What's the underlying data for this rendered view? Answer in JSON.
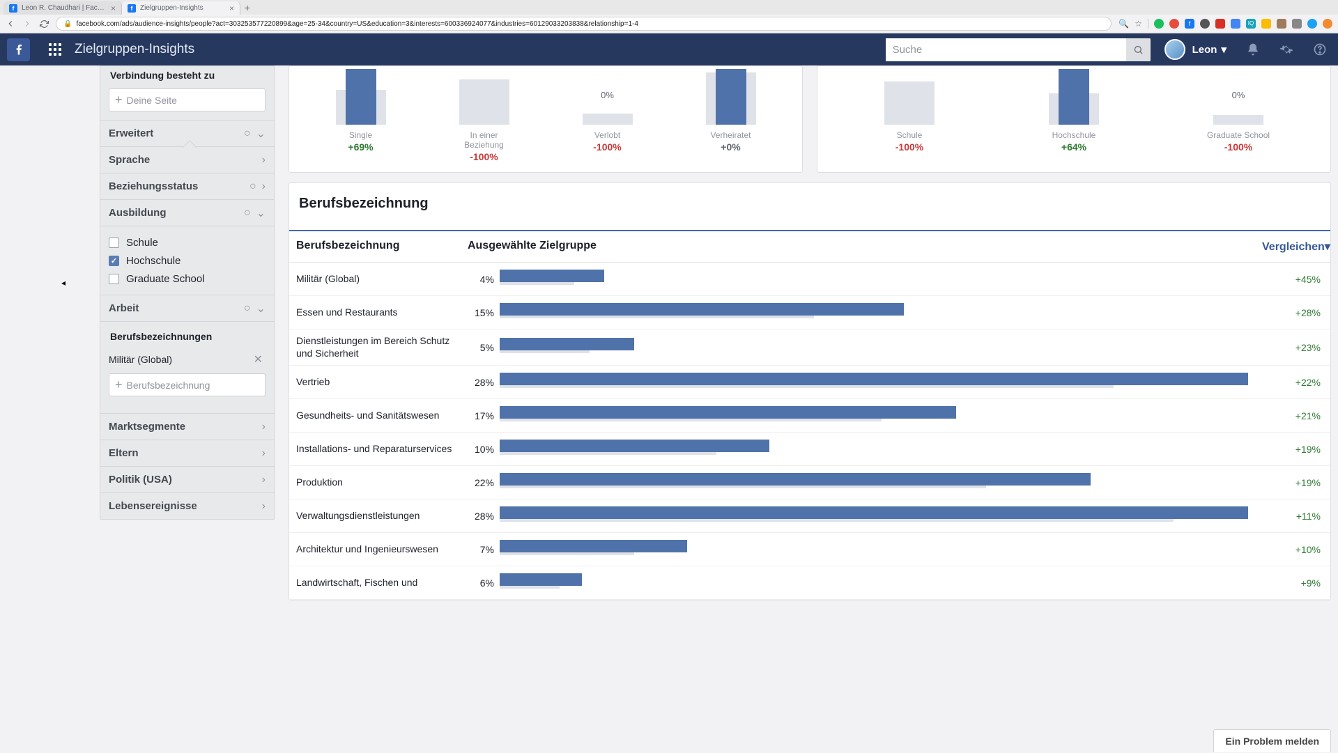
{
  "browser": {
    "tabs": [
      {
        "title": "Leon R. Chaudhari | Facebook",
        "active": false
      },
      {
        "title": "Zielgruppen-Insights",
        "active": true
      }
    ],
    "url": "facebook.com/ads/audience-insights/people?act=303253577220899&age=25-34&country=US&education=3&interests=600336924077&industries=60129033203838&relationship=1-4"
  },
  "header": {
    "page_title": "Zielgruppen-Insights",
    "search_placeholder": "Suche",
    "user_name": "Leon"
  },
  "sidebar": {
    "verbindung_title": "Verbindung besteht zu",
    "deine_seite_ph": "Deine Seite",
    "erw": "Erweitert",
    "sprache": "Sprache",
    "beziehung": "Beziehungsstatus",
    "ausbildung": "Ausbildung",
    "edu_opts": {
      "schule": "Schule",
      "hochschule": "Hochschule",
      "grad": "Graduate School"
    },
    "arbeit": "Arbeit",
    "beruf_title": "Berufsbezeichnungen",
    "beruf_tag": "Militär (Global)",
    "beruf_ph": "Berufsbezeichnung",
    "markt": "Marktsegmente",
    "eltern": "Eltern",
    "politik": "Politik (USA)",
    "leben": "Lebensereignisse"
  },
  "charts": {
    "left": {
      "top_pct": "0%",
      "free_pct": "0%",
      "cols": [
        {
          "label": "Single",
          "delta": "+69%",
          "cls": "pos",
          "fg": 80,
          "bg": 50
        },
        {
          "label": "In einer Beziehung",
          "delta": "-100%",
          "cls": "neg",
          "fg": 0,
          "bg": 65
        },
        {
          "label": "Verlobt",
          "delta": "-100%",
          "cls": "neg",
          "fg": 0,
          "bg": 16
        },
        {
          "label": "Verheiratet",
          "delta": "+0%",
          "cls": "neu",
          "fg": 80,
          "bg": 75
        }
      ]
    },
    "right": {
      "top_pct": "0%",
      "free_pct": "0%",
      "cols": [
        {
          "label": "Schule",
          "delta": "-100%",
          "cls": "neg",
          "fg": 0,
          "bg": 62
        },
        {
          "label": "Hochschule",
          "delta": "+64%",
          "cls": "pos",
          "fg": 80,
          "bg": 45
        },
        {
          "label": "Graduate School",
          "delta": "-100%",
          "cls": "neg",
          "fg": 0,
          "bg": 14
        }
      ]
    }
  },
  "table": {
    "title": "Berufsbezeichnung",
    "h_name": "Berufsbezeichnung",
    "h_bar": "Ausgewählte Zielgruppe",
    "h_cmp": "Vergleichen",
    "rows": [
      {
        "name": "Militär (Global)",
        "pct": "4%",
        "fg": 14,
        "bg": 10,
        "delta": "+45%",
        "cls": "pos"
      },
      {
        "name": "Essen und Restaurants",
        "pct": "15%",
        "fg": 54,
        "bg": 42,
        "delta": "+28%",
        "cls": "pos"
      },
      {
        "name": "Dienstleistungen im Bereich Schutz und Sicherheit",
        "pct": "5%",
        "fg": 18,
        "bg": 12,
        "delta": "+23%",
        "cls": "pos"
      },
      {
        "name": "Vertrieb",
        "pct": "28%",
        "fg": 100,
        "bg": 82,
        "delta": "+22%",
        "cls": "pos"
      },
      {
        "name": "Gesundheits- und Sanitätswesen",
        "pct": "17%",
        "fg": 61,
        "bg": 51,
        "delta": "+21%",
        "cls": "pos"
      },
      {
        "name": "Installations- und Reparaturservices",
        "pct": "10%",
        "fg": 36,
        "bg": 29,
        "delta": "+19%",
        "cls": "pos"
      },
      {
        "name": "Produktion",
        "pct": "22%",
        "fg": 79,
        "bg": 65,
        "delta": "+19%",
        "cls": "pos"
      },
      {
        "name": "Verwaltungsdienstleistungen",
        "pct": "28%",
        "fg": 100,
        "bg": 90,
        "delta": "+11%",
        "cls": "pos"
      },
      {
        "name": "Architektur und Ingenieurswesen",
        "pct": "7%",
        "fg": 25,
        "bg": 18,
        "delta": "+10%",
        "cls": "pos"
      },
      {
        "name": "Landwirtschaft, Fischen und",
        "pct": "6%",
        "fg": 11,
        "bg": 8,
        "delta": "+9%",
        "cls": "pos"
      }
    ]
  },
  "report_label": "Ein Problem melden",
  "colors": {
    "accent": "#4267b2",
    "bar_fg": "#5072aa",
    "bar_bg": "#dfe2e8",
    "pos": "#2f7a33",
    "neg": "#c83a3a"
  }
}
